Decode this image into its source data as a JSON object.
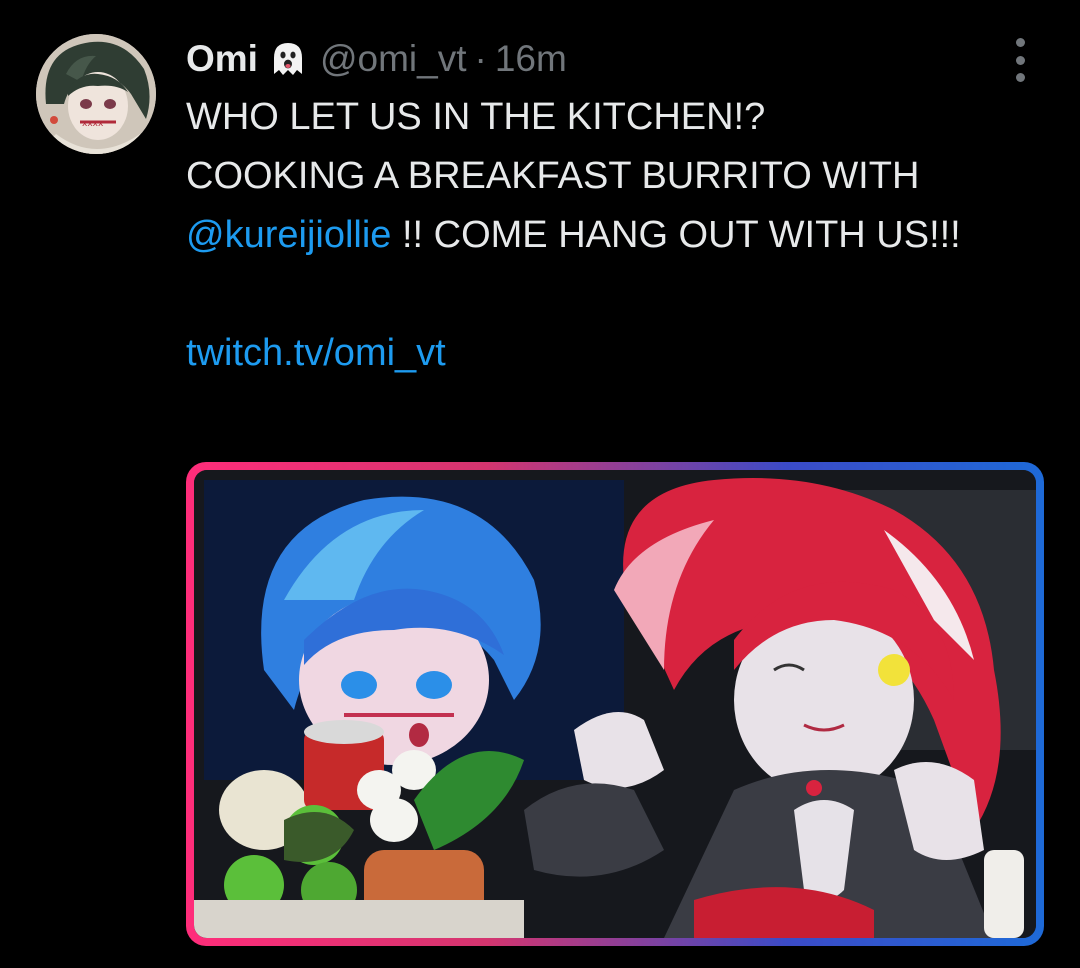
{
  "tweet": {
    "author_name": "Omi",
    "author_emoji": "👻",
    "handle": "@omi_vt",
    "separator": "·",
    "time": "16m",
    "text_line1": "WHO LET US IN THE KITCHEN!?",
    "text_line2_before": "COOKING A BREAKFAST BURRITO WITH ",
    "mention": "@kureijiollie",
    "text_line2_after": " !! COME HANG OUT WITH US!!!",
    "link": "twitch.tv/omi_vt"
  },
  "icons": {
    "more": "more-vertical-icon",
    "emoji": "ghost-emoji-icon"
  },
  "colors": {
    "background": "#000000",
    "text": "#e7e9ea",
    "muted": "#71767b",
    "link": "#1d9bf0"
  }
}
